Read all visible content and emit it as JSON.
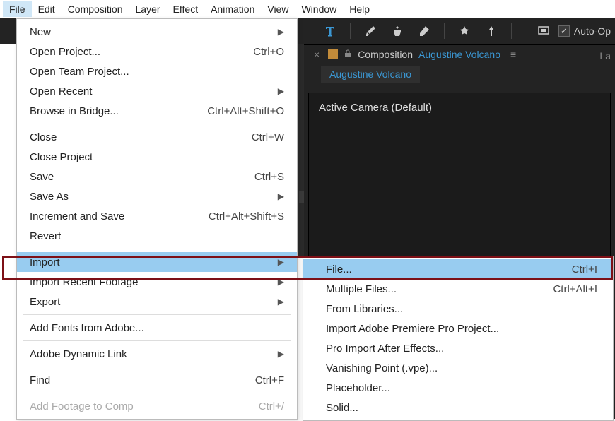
{
  "menubar": {
    "items": [
      "File",
      "Edit",
      "Composition",
      "Layer",
      "Effect",
      "Animation",
      "View",
      "Window",
      "Help"
    ],
    "active_index": 0
  },
  "toolbar": {
    "auto_open_label": "Auto-Op"
  },
  "composition_panel": {
    "tab_label": "Composition",
    "comp_name": "Augustine Volcano",
    "layer_tab": "La",
    "breadcrumb": "Augustine Volcano",
    "viewer_text": "Active Camera (Default)"
  },
  "file_menu": {
    "items": [
      {
        "label": "New",
        "shortcut": "",
        "arrow": true
      },
      {
        "label": "Open Project...",
        "shortcut": "Ctrl+O"
      },
      {
        "label": "Open Team Project..."
      },
      {
        "label": "Open Recent",
        "arrow": true
      },
      {
        "label": "Browse in Bridge...",
        "shortcut": "Ctrl+Alt+Shift+O"
      },
      {
        "sep": true
      },
      {
        "label": "Close",
        "shortcut": "Ctrl+W"
      },
      {
        "label": "Close Project"
      },
      {
        "label": "Save",
        "shortcut": "Ctrl+S"
      },
      {
        "label": "Save As",
        "arrow": true
      },
      {
        "label": "Increment and Save",
        "shortcut": "Ctrl+Alt+Shift+S"
      },
      {
        "label": "Revert"
      },
      {
        "sep": true
      },
      {
        "label": "Import",
        "arrow": true,
        "highlighted": true
      },
      {
        "label": "Import Recent Footage",
        "arrow": true
      },
      {
        "label": "Export",
        "arrow": true
      },
      {
        "sep": true
      },
      {
        "label": "Add Fonts from Adobe..."
      },
      {
        "sep": true
      },
      {
        "label": "Adobe Dynamic Link",
        "arrow": true
      },
      {
        "sep": true
      },
      {
        "label": "Find",
        "shortcut": "Ctrl+F"
      },
      {
        "sep": true
      },
      {
        "label": "Add Footage to Comp",
        "shortcut": "Ctrl+/",
        "disabled": true
      }
    ]
  },
  "import_submenu": {
    "items": [
      {
        "label": "File...",
        "shortcut": "Ctrl+I",
        "highlighted": true
      },
      {
        "label": "Multiple Files...",
        "shortcut": "Ctrl+Alt+I"
      },
      {
        "label": "From Libraries..."
      },
      {
        "label": "Import Adobe Premiere Pro Project..."
      },
      {
        "label": "Pro Import After Effects..."
      },
      {
        "label": "Vanishing Point (.vpe)..."
      },
      {
        "label": "Placeholder..."
      },
      {
        "label": "Solid..."
      }
    ]
  }
}
